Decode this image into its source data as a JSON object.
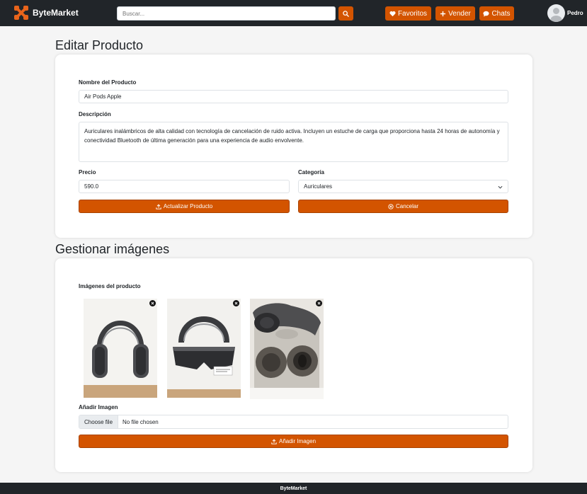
{
  "navbar": {
    "brand": "ByteMarket",
    "search_placeholder": "Buscar...",
    "favorites_label": "Favoritos",
    "sell_label": "Vender",
    "chats_label": "Chats",
    "user_name": "Pedro",
    "accent_color": "#d35400"
  },
  "edit_section": {
    "title": "Editar Producto",
    "name_label": "Nombre del Producto",
    "name_value": "Air Pods Apple",
    "description_label": "Descripción",
    "description_value": "Auriculares inalámbricos de alta calidad con tecnología de cancelación de ruido activa. Incluyen un estuche de carga que proporciona hasta 24 horas de autonomía y conectividad Bluetooth de última generación para una experiencia de audio envolvente.",
    "price_label": "Precio",
    "price_value": "590.0",
    "category_label": "Categoría",
    "category_value": "Auriculares",
    "update_button": "Actualizar Producto",
    "cancel_button": "Cancelar"
  },
  "images_section": {
    "title": "Gestionar imágenes",
    "images_label": "Imágenes del producto",
    "images": [
      {
        "icon": "headphones-front-photo"
      },
      {
        "icon": "headphones-case-photo"
      },
      {
        "icon": "headphones-open-box-photo"
      }
    ],
    "add_image_label": "Añadir Imagen",
    "choose_file_button": "Choose file",
    "no_file_text": "No file chosen",
    "add_image_button": "Añadir Imagen"
  },
  "footer": {
    "text": "ByteMarket"
  }
}
